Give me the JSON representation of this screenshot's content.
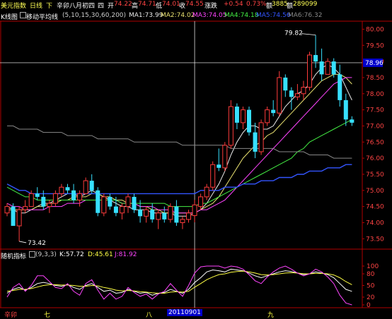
{
  "topbar": {
    "title": "美元指数",
    "period": "日线",
    "arrow": "下",
    "lunar": "辛卯八月初四",
    "weekday": "四",
    "open_label": "开",
    "open": "74.22",
    "high_label": "高",
    "high": "74.71",
    "low_label": "低",
    "low": "74.01",
    "close_label": "收",
    "close": "74.55",
    "change_label": "涨跌",
    "change": "+0.54",
    "pct": "0.73%",
    "volume_label": "额",
    "volume": "3885",
    "amount_label": "额",
    "amount": "289099"
  },
  "legend": {
    "kline_label": "K线图",
    "ma_name": "移动平均线",
    "ma_params": "(5,10,15,30,60,200)",
    "ma1": "MA1:73.99",
    "ma2": "MA2:74.02",
    "ma3": "MA3:74.05",
    "ma4": "MA4:74.18",
    "ma5": "MA5:74.56",
    "ma6": "MA6:76.32"
  },
  "stoch": {
    "name": "随机指标",
    "params": "(9,3,3)",
    "k": "K:57.72",
    "d": "D:45.61",
    "j": "J:81.92"
  },
  "bottom_axis": {
    "year": "辛卯",
    "month7": "七",
    "month8": "八",
    "date": "20110901",
    "month9": "九"
  },
  "colors": {
    "up": "#ff3c3c",
    "down": "#37e0ff",
    "ma1": "#e8e8e8",
    "ma2": "#e8e070",
    "ma3": "#ff44ff",
    "ma4": "#44ee44",
    "ma5": "#3355ff",
    "ma6": "#888888",
    "k": "#ffffff",
    "d": "#ffff44",
    "j": "#ff44ff",
    "cursor": "#ffffff"
  },
  "chart_data": {
    "type": "candlestick",
    "price_axis": {
      "ticks": [
        "80.00",
        "79.50",
        "79.00",
        "78.50",
        "78.00",
        "77.50",
        "77.00",
        "76.50",
        "76.00",
        "75.50",
        "75.00",
        "74.50",
        "74.00",
        "73.50"
      ],
      "cursor_value": "78.96"
    },
    "annotations": {
      "high": "79.82",
      "low": "73.42"
    },
    "stoch_axis": {
      "ticks": [
        "100",
        "80",
        "50",
        "20",
        "0"
      ]
    },
    "candles": [
      [
        74.3,
        74.6,
        74.2,
        74.5
      ],
      [
        74.5,
        74.6,
        73.9,
        73.9
      ],
      [
        73.9,
        74.5,
        73.42,
        74.4
      ],
      [
        74.4,
        74.7,
        74.3,
        74.5
      ],
      [
        74.5,
        75.0,
        74.5,
        74.9
      ],
      [
        74.9,
        75.1,
        74.7,
        74.8
      ],
      [
        74.8,
        75.0,
        74.4,
        74.5
      ],
      [
        74.5,
        74.7,
        74.3,
        74.6
      ],
      [
        74.6,
        75.0,
        74.5,
        74.9
      ],
      [
        74.9,
        75.2,
        74.8,
        75.1
      ],
      [
        75.1,
        75.2,
        74.9,
        75.0
      ],
      [
        75.0,
        75.2,
        74.6,
        74.7
      ],
      [
        74.7,
        75.0,
        74.5,
        74.9
      ],
      [
        74.9,
        75.4,
        74.9,
        75.3
      ],
      [
        75.3,
        75.5,
        74.9,
        75.0
      ],
      [
        75.0,
        75.1,
        74.2,
        74.3
      ],
      [
        74.3,
        74.9,
        74.2,
        74.8
      ],
      [
        74.8,
        74.9,
        74.4,
        74.5
      ],
      [
        74.5,
        74.8,
        74.2,
        74.3
      ],
      [
        74.3,
        74.6,
        74.1,
        74.5
      ],
      [
        74.5,
        74.9,
        74.3,
        74.8
      ],
      [
        74.8,
        74.9,
        74.3,
        74.4
      ],
      [
        74.4,
        74.7,
        74.0,
        74.2
      ],
      [
        74.2,
        74.5,
        74.0,
        74.4
      ],
      [
        74.4,
        74.6,
        74.0,
        74.1
      ],
      [
        74.1,
        74.4,
        73.8,
        74.3
      ],
      [
        74.3,
        74.5,
        74.0,
        74.1
      ],
      [
        74.1,
        74.6,
        74.0,
        74.5
      ],
      [
        74.5,
        74.7,
        73.9,
        74.0
      ],
      [
        74.0,
        74.2,
        73.8,
        74.1
      ],
      [
        74.1,
        74.4,
        74.0,
        74.3
      ],
      [
        74.22,
        74.71,
        74.01,
        74.55
      ],
      [
        74.5,
        74.9,
        74.4,
        74.8
      ],
      [
        74.8,
        75.2,
        74.7,
        75.1
      ],
      [
        75.1,
        75.9,
        75.0,
        75.8
      ],
      [
        75.8,
        76.3,
        75.6,
        75.7
      ],
      [
        75.7,
        76.5,
        75.6,
        76.4
      ],
      [
        76.4,
        77.8,
        76.3,
        77.6
      ],
      [
        77.6,
        77.7,
        76.9,
        77.1
      ],
      [
        77.1,
        77.6,
        76.9,
        77.5
      ],
      [
        77.5,
        77.6,
        76.7,
        76.8
      ],
      [
        76.8,
        77.1,
        76.0,
        76.2
      ],
      [
        76.2,
        77.2,
        76.1,
        77.1
      ],
      [
        77.1,
        77.6,
        77.0,
        77.5
      ],
      [
        77.5,
        77.8,
        77.3,
        77.4
      ],
      [
        77.4,
        78.7,
        77.3,
        78.5
      ],
      [
        78.5,
        78.6,
        77.9,
        78.1
      ],
      [
        78.1,
        78.2,
        77.5,
        77.9
      ],
      [
        77.9,
        78.3,
        77.8,
        78.0
      ],
      [
        78.0,
        78.4,
        77.8,
        78.2
      ],
      [
        78.2,
        79.3,
        78.1,
        79.2
      ],
      [
        79.2,
        79.82,
        78.8,
        79.0
      ],
      [
        79.0,
        79.4,
        78.4,
        78.6
      ],
      [
        78.6,
        79.1,
        78.6,
        79.0
      ],
      [
        79.0,
        79.1,
        78.5,
        78.6
      ],
      [
        78.6,
        78.9,
        77.6,
        77.8
      ],
      [
        77.8,
        78.0,
        77.0,
        77.2
      ],
      [
        77.2,
        77.3,
        77.0,
        77.1
      ]
    ],
    "ma_series": [
      {
        "name": "MA1",
        "values": [
          74.5,
          74.4,
          74.3,
          74.3,
          74.4,
          74.5,
          74.6,
          74.6,
          74.7,
          74.8,
          74.9,
          74.9,
          74.8,
          74.9,
          75.0,
          74.9,
          74.8,
          74.7,
          74.6,
          74.5,
          74.5,
          74.4,
          74.4,
          74.4,
          74.3,
          74.3,
          74.3,
          74.3,
          74.2,
          74.2,
          74.2,
          74.3,
          74.4,
          74.6,
          74.9,
          75.2,
          75.6,
          76.1,
          76.5,
          76.8,
          77.0,
          77.0,
          76.9,
          76.9,
          77.0,
          77.3,
          77.6,
          77.8,
          78.0,
          78.1,
          78.3,
          78.6,
          78.8,
          78.9,
          78.8,
          78.6,
          78.2,
          77.8
        ]
      },
      {
        "name": "MA2",
        "values": [
          74.4,
          74.4,
          74.4,
          74.4,
          74.4,
          74.5,
          74.5,
          74.6,
          74.6,
          74.7,
          74.7,
          74.8,
          74.8,
          74.8,
          74.9,
          74.9,
          74.8,
          74.8,
          74.7,
          74.7,
          74.6,
          74.6,
          74.5,
          74.5,
          74.4,
          74.4,
          74.3,
          74.3,
          74.3,
          74.3,
          74.3,
          74.3,
          74.4,
          74.5,
          74.6,
          74.8,
          75.1,
          75.4,
          75.7,
          76.0,
          76.2,
          76.4,
          76.5,
          76.7,
          76.8,
          77.0,
          77.2,
          77.4,
          77.6,
          77.8,
          78.0,
          78.2,
          78.4,
          78.5,
          78.6,
          78.6,
          78.5,
          78.3
        ]
      },
      {
        "name": "MA3",
        "values": [
          74.6,
          74.5,
          74.5,
          74.4,
          74.4,
          74.4,
          74.4,
          74.5,
          74.5,
          74.5,
          74.6,
          74.6,
          74.6,
          74.7,
          74.7,
          74.7,
          74.7,
          74.7,
          74.7,
          74.6,
          74.6,
          74.6,
          74.5,
          74.5,
          74.5,
          74.4,
          74.4,
          74.4,
          74.3,
          74.3,
          74.3,
          74.3,
          74.4,
          74.4,
          74.5,
          74.6,
          74.7,
          74.9,
          75.1,
          75.3,
          75.5,
          75.7,
          75.9,
          76.1,
          76.3,
          76.5,
          76.7,
          76.9,
          77.1,
          77.3,
          77.5,
          77.7,
          77.9,
          78.1,
          78.3,
          78.4,
          78.5,
          78.5
        ]
      },
      {
        "name": "MA4",
        "values": [
          75.1,
          75.0,
          74.9,
          74.8,
          74.8,
          74.7,
          74.7,
          74.7,
          74.7,
          74.7,
          74.7,
          74.7,
          74.7,
          74.7,
          74.7,
          74.7,
          74.7,
          74.7,
          74.7,
          74.6,
          74.6,
          74.6,
          74.6,
          74.6,
          74.6,
          74.6,
          74.6,
          74.5,
          74.5,
          74.5,
          74.5,
          74.5,
          74.6,
          74.6,
          74.7,
          74.8,
          74.9,
          75.0,
          75.1,
          75.2,
          75.3,
          75.4,
          75.5,
          75.6,
          75.7,
          75.8,
          75.9,
          76.0,
          76.2,
          76.3,
          76.5,
          76.6,
          76.7,
          76.8,
          76.9,
          77.0,
          77.1,
          77.2
        ]
      },
      {
        "name": "MA5",
        "values": [
          75.2,
          75.1,
          75.0,
          75.0,
          74.9,
          74.9,
          74.9,
          74.9,
          74.9,
          74.9,
          74.9,
          74.9,
          74.9,
          74.9,
          74.9,
          74.9,
          74.9,
          74.9,
          74.9,
          74.9,
          74.9,
          74.9,
          74.9,
          74.9,
          74.9,
          74.9,
          74.9,
          74.9,
          74.9,
          74.9,
          74.9,
          74.9,
          75.0,
          75.0,
          75.0,
          75.0,
          75.1,
          75.1,
          75.1,
          75.2,
          75.2,
          75.2,
          75.3,
          75.3,
          75.3,
          75.4,
          75.4,
          75.4,
          75.5,
          75.5,
          75.6,
          75.6,
          75.6,
          75.7,
          75.7,
          75.7,
          75.8,
          75.8
        ]
      },
      {
        "name": "MA6",
        "values": [
          77.0,
          77.0,
          76.9,
          76.9,
          76.9,
          76.9,
          76.8,
          76.8,
          76.8,
          76.8,
          76.7,
          76.7,
          76.7,
          76.7,
          76.7,
          76.6,
          76.6,
          76.6,
          76.6,
          76.6,
          76.6,
          76.5,
          76.5,
          76.5,
          76.5,
          76.5,
          76.5,
          76.5,
          76.5,
          76.4,
          76.4,
          76.4,
          76.4,
          76.4,
          76.4,
          76.4,
          76.4,
          76.3,
          76.3,
          76.3,
          76.3,
          76.3,
          76.3,
          76.3,
          76.3,
          76.2,
          76.2,
          76.2,
          76.2,
          76.2,
          76.1,
          76.1,
          76.1,
          76.1,
          76.0,
          76.0,
          76.0,
          76.0
        ]
      }
    ],
    "stoch_series": [
      {
        "name": "K",
        "values": [
          30,
          40,
          45,
          38,
          45,
          55,
          58,
          55,
          50,
          48,
          52,
          45,
          40,
          50,
          55,
          45,
          35,
          38,
          30,
          32,
          40,
          35,
          30,
          32,
          25,
          30,
          32,
          40,
          35,
          30,
          40,
          57.72,
          70,
          85,
          90,
          88,
          85,
          92,
          90,
          88,
          82,
          75,
          70,
          75,
          80,
          85,
          88,
          86,
          82,
          78,
          80,
          85,
          82,
          78,
          70,
          55,
          40,
          35
        ]
      },
      {
        "name": "D",
        "values": [
          35,
          37,
          40,
          40,
          42,
          46,
          50,
          52,
          52,
          51,
          51,
          50,
          48,
          48,
          50,
          49,
          45,
          42,
          38,
          36,
          37,
          36,
          34,
          33,
          31,
          30,
          30,
          33,
          34,
          33,
          35,
          45.61,
          55,
          65,
          72,
          78,
          80,
          84,
          86,
          87,
          85,
          82,
          78,
          77,
          78,
          80,
          82,
          83,
          82,
          80,
          80,
          81,
          81,
          80,
          77,
          70,
          60,
          52
        ]
      },
      {
        "name": "J",
        "values": [
          20,
          45,
          55,
          35,
          50,
          75,
          75,
          60,
          45,
          42,
          55,
          35,
          25,
          55,
          65,
          38,
          15,
          30,
          15,
          22,
          45,
          32,
          22,
          28,
          15,
          28,
          35,
          55,
          38,
          22,
          50,
          81.92,
          98,
          100,
          100,
          100,
          95,
          100,
          98,
          92,
          78,
          62,
          55,
          72,
          85,
          95,
          100,
          92,
          82,
          75,
          80,
          92,
          85,
          72,
          55,
          25,
          5,
          0
        ]
      }
    ]
  }
}
